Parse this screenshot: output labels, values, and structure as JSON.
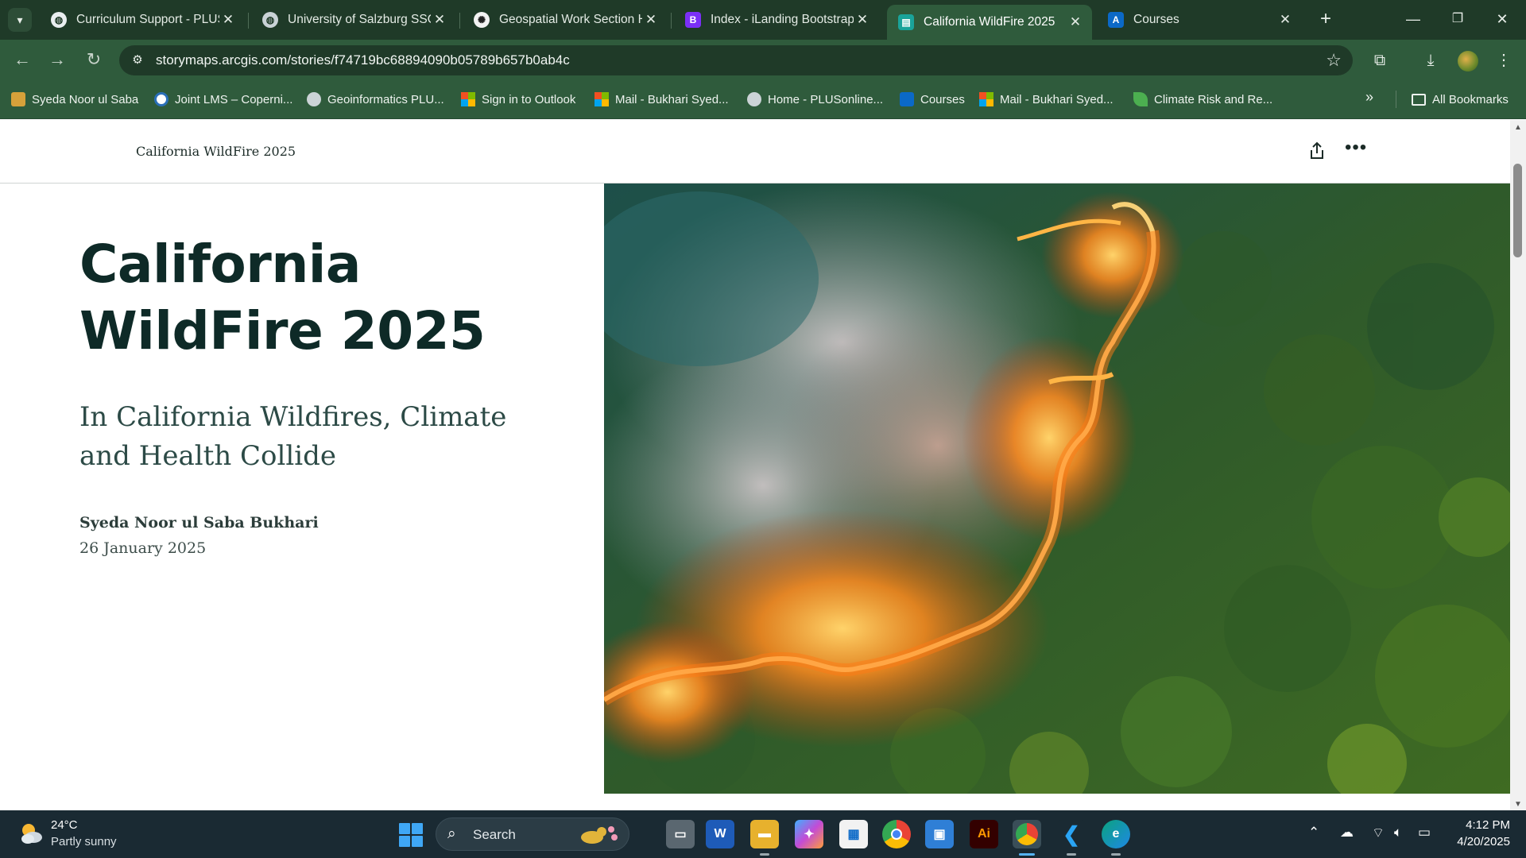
{
  "browser": {
    "tabs": [
      {
        "label": "Curriculum Support - PLUS",
        "favicon": "globe-icon",
        "active": false
      },
      {
        "label": "University of Salzburg SSO",
        "favicon": "globe-icon",
        "active": false
      },
      {
        "label": "Geospatial Work Section H",
        "favicon": "openai-icon",
        "active": false
      },
      {
        "label": "Index - iLanding Bootstrap",
        "favicon": "bootstrap-icon",
        "active": false
      },
      {
        "label": "California WildFire 2025",
        "favicon": "storymaps-icon",
        "active": true
      },
      {
        "label": "Courses",
        "favicon": "arcgis-icon",
        "active": false
      }
    ],
    "url": "storymaps.arcgis.com/stories/f74719bc68894090b05789b657b0ab4c",
    "bookmarks": [
      {
        "label": "Syeda Noor ul Saba",
        "icon": "bookmark-icon"
      },
      {
        "label": "Joint LMS – Coperni...",
        "icon": "lms-icon"
      },
      {
        "label": "Geoinformatics PLU...",
        "icon": "globe-icon"
      },
      {
        "label": "Sign in to Outlook",
        "icon": "microsoft-icon"
      },
      {
        "label": "Mail - Bukhari Syed...",
        "icon": "microsoft-icon"
      },
      {
        "label": "Home - PLUSonline...",
        "icon": "globe-icon"
      },
      {
        "label": "Courses",
        "icon": "arcgis-icon"
      },
      {
        "label": "Mail - Bukhari Syed...",
        "icon": "microsoft-icon"
      },
      {
        "label": "Climate Risk and Re...",
        "icon": "leaf-icon"
      }
    ],
    "all_bookmarks_label": "All Bookmarks"
  },
  "story": {
    "header_title": "California WildFire 2025",
    "title": "California WildFire 2025",
    "subtitle": "In California Wildfires, Climate and Health Collide",
    "author": "Syeda Noor ul Saba Bukhari",
    "date": "26 January 2025",
    "hero_image": "aerial-forest-wildfire-image"
  },
  "taskbar": {
    "weather_temp": "24°C",
    "weather_desc": "Partly sunny",
    "search_label": "Search",
    "apps": [
      "task-view-icon",
      "word-icon",
      "file-explorer-icon",
      "copilot-icon",
      "microsoft-store-icon",
      "chrome-icon",
      "notepad-icon",
      "illustrator-icon",
      "chrome-profile-icon",
      "vscode-icon",
      "edge-icon"
    ],
    "illustrator_label": "Ai",
    "time": "4:12 PM",
    "date": "4/20/2025"
  },
  "colors": {
    "browser_frame": "#1f3a28",
    "browser_toolbar": "#2f5b3c",
    "title_text": "#0e2a27",
    "taskbar": "#1a2a33"
  }
}
